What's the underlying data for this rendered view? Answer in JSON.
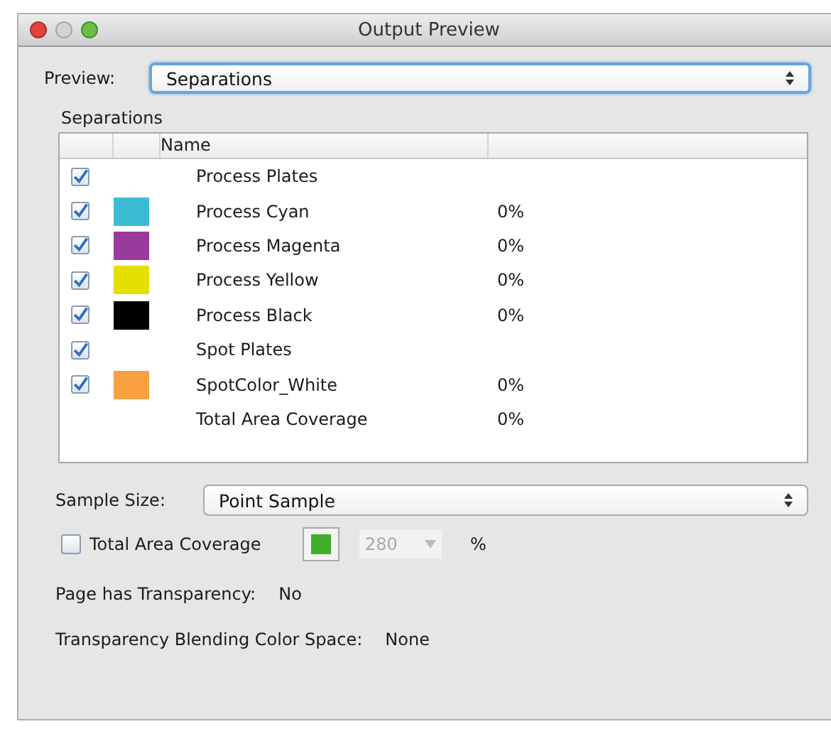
{
  "window": {
    "title": "Output Preview"
  },
  "preview": {
    "label": "Preview:",
    "value": "Separations",
    "focused": true
  },
  "separations": {
    "title": "Separations",
    "columns": [
      "Name"
    ],
    "rows": [
      {
        "kind": "plate",
        "checked": true,
        "name": "Process Plates"
      },
      {
        "kind": "plate",
        "checked": true,
        "color": "#3cbcd4",
        "name": "Process Cyan",
        "value": "0%"
      },
      {
        "kind": "plate",
        "checked": true,
        "color": "#9a3a9e",
        "name": "Process Magenta",
        "value": "0%"
      },
      {
        "kind": "plate",
        "checked": true,
        "color": "#e6e000",
        "name": "Process Yellow",
        "value": "0%"
      },
      {
        "kind": "plate",
        "checked": true,
        "color": "#000000",
        "name": "Process Black",
        "value": "0%"
      },
      {
        "kind": "plate",
        "checked": true,
        "name": "Spot Plates"
      },
      {
        "kind": "plate",
        "checked": true,
        "color": "#f6a040",
        "name": "SpotColor_White",
        "value": "0%"
      },
      {
        "kind": "total",
        "name": "Total Area Coverage",
        "value": "0%"
      }
    ]
  },
  "sample_size": {
    "label": "Sample Size:",
    "value": "Point Sample"
  },
  "coverage": {
    "checked": false,
    "label": "Total Area Coverage",
    "color": "#3fae2a",
    "value": "280",
    "disabled": true,
    "unit": "%"
  },
  "info": [
    {
      "label": "Page has Transparency:",
      "value": "No"
    },
    {
      "label": "Transparency Blending Color Space:",
      "value": "None"
    }
  ]
}
